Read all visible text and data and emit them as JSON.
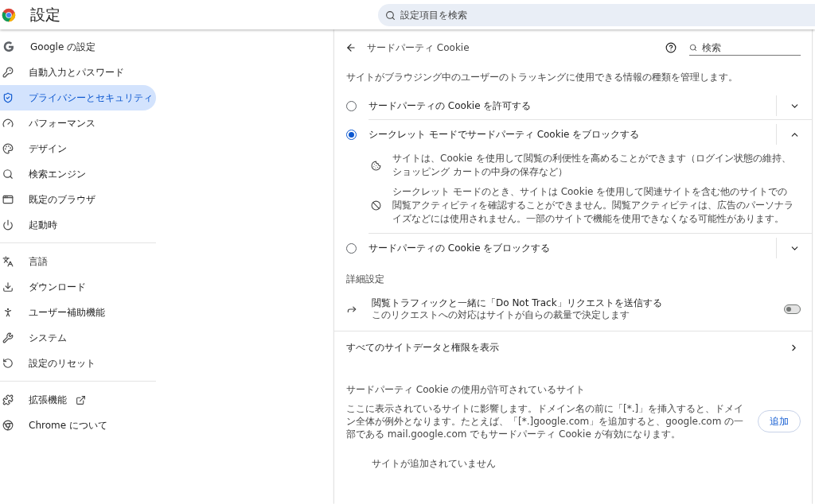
{
  "header": {
    "title": "設定",
    "search_placeholder": "設定項目を検索"
  },
  "sidebar": {
    "groups": [
      [
        {
          "label": "Google の設定",
          "selected": false
        },
        {
          "label": "自動入力とパスワード",
          "selected": false
        },
        {
          "label": "プライバシーとセキュリティ",
          "selected": true
        },
        {
          "label": "パフォーマンス",
          "selected": false
        },
        {
          "label": "デザイン",
          "selected": false
        },
        {
          "label": "検索エンジン",
          "selected": false
        },
        {
          "label": "既定のブラウザ",
          "selected": false
        },
        {
          "label": "起動時",
          "selected": false
        }
      ],
      [
        {
          "label": "言語",
          "selected": false
        },
        {
          "label": "ダウンロード",
          "selected": false
        },
        {
          "label": "ユーザー補助機能",
          "selected": false
        },
        {
          "label": "システム",
          "selected": false
        },
        {
          "label": "設定のリセット",
          "selected": false
        }
      ],
      [
        {
          "label": "拡張機能",
          "selected": false,
          "external": true
        },
        {
          "label": "Chrome について",
          "selected": false
        }
      ]
    ]
  },
  "page": {
    "title": "サードパーティ Cookie",
    "search_placeholder": "検索",
    "description": "サイトがブラウジング中のユーザーのトラッキングに使用できる情報の種類を管理します。",
    "options": [
      {
        "label": "サードパーティの Cookie を許可する",
        "selected": false,
        "expanded": false
      },
      {
        "label": "シークレット モードでサードパーティ Cookie をブロックする",
        "selected": true,
        "expanded": true,
        "details": [
          "サイトは、Cookie を使用して閲覧の利便性を高めることができます（ログイン状態の維持、ショッピング カートの中身の保存など）",
          "シークレット モードのとき、サイトは Cookie を使用して関連サイトを含む他のサイトでの閲覧アクティビティを確認することができません。閲覧アクティビティは、広告のパーソナライズなどには使用されません。一部のサイトで機能を使用できなくなる可能性があります。"
        ]
      },
      {
        "label": "サードパーティの Cookie をブロックする",
        "selected": false,
        "expanded": false
      }
    ],
    "advanced_heading": "詳細設定",
    "dnt": {
      "title": "閲覧トラフィックと一緒に「Do Not Track」リクエストを送信する",
      "subtitle": "このリクエストへの対応はサイトが自らの裁量で決定します",
      "on": false
    },
    "all_sites_link": "すべてのサイトデータと権限を表示",
    "allowed": {
      "heading": "サードパーティ Cookie の使用が許可されているサイト",
      "description": "ここに表示されているサイトに影響します。ドメイン名の前に「[*.]」を挿入すると、ドメイン全体が例外となります。たとえば、「[*.]google.com」を追加すると、google.com の一部である mail.google.com でもサードパーティ Cookie が有効になります。",
      "add_button": "追加",
      "empty": "サイトが追加されていません"
    }
  }
}
